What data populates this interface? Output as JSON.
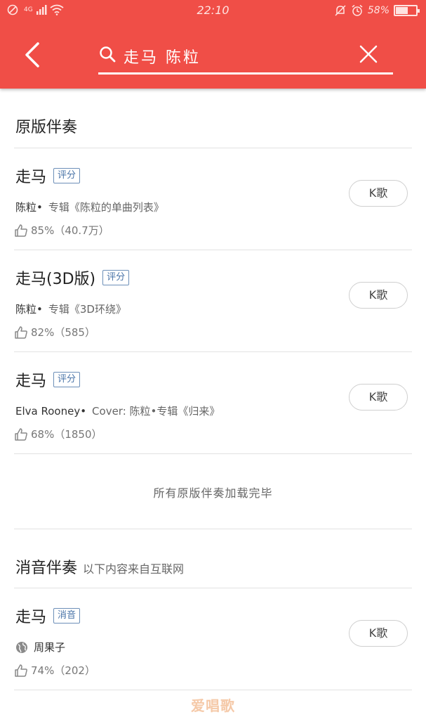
{
  "status_bar": {
    "signal": "4G",
    "time": "22:10",
    "battery_percent": "58%",
    "battery_level": 0.58
  },
  "header": {
    "search_query": "走马  陈粒"
  },
  "sections": {
    "original": {
      "title": "原版伴奏",
      "end_note": "所有原版伴奏加载完毕"
    },
    "vocal_removed": {
      "title": "消音伴奏",
      "subtitle": "以下内容来自互联网"
    }
  },
  "songs": [
    {
      "title": "走马",
      "tag": "评分",
      "artist": "陈粒•",
      "album": "专辑《陈粒的单曲列表》",
      "stats": "85%（40.7万）",
      "button": "K歌"
    },
    {
      "title": "走马(3D版)",
      "tag": "评分",
      "artist": "陈粒•",
      "album": "专辑《3D环绕》",
      "stats": "82%（585）",
      "button": "K歌"
    },
    {
      "title": "走马",
      "tag": "评分",
      "artist": "Elva Rooney•",
      "album": "Cover: 陈粒•专辑《归来》",
      "stats": "68%（1850）",
      "button": "K歌"
    },
    {
      "title": "走马",
      "tag": "消音",
      "artist": "周果子",
      "album": "",
      "stats": "74%（202）",
      "button": "K歌"
    }
  ],
  "watermark": "爱唱歌",
  "colors": {
    "header_bg": "#f04e47",
    "tag_blue": "#4a74a8"
  }
}
